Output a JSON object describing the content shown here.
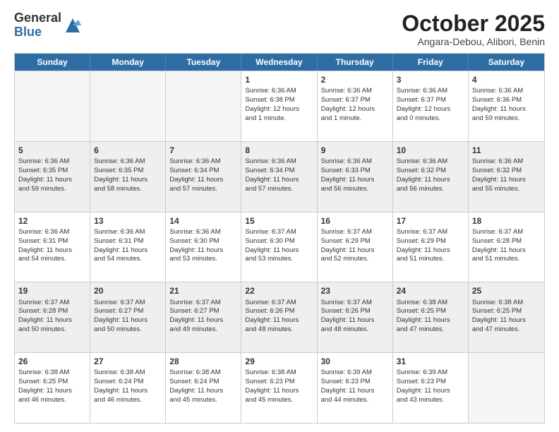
{
  "logo": {
    "general": "General",
    "blue": "Blue"
  },
  "header": {
    "month": "October 2025",
    "location": "Angara-Debou, Alibori, Benin"
  },
  "days": [
    "Sunday",
    "Monday",
    "Tuesday",
    "Wednesday",
    "Thursday",
    "Friday",
    "Saturday"
  ],
  "weeks": [
    [
      {
        "day": "",
        "info": "",
        "empty": true
      },
      {
        "day": "",
        "info": "",
        "empty": true
      },
      {
        "day": "",
        "info": "",
        "empty": true
      },
      {
        "day": "1",
        "info": "Sunrise: 6:36 AM\nSunset: 6:38 PM\nDaylight: 12 hours\nand 1 minute.",
        "empty": false
      },
      {
        "day": "2",
        "info": "Sunrise: 6:36 AM\nSunset: 6:37 PM\nDaylight: 12 hours\nand 1 minute.",
        "empty": false
      },
      {
        "day": "3",
        "info": "Sunrise: 6:36 AM\nSunset: 6:37 PM\nDaylight: 12 hours\nand 0 minutes.",
        "empty": false
      },
      {
        "day": "4",
        "info": "Sunrise: 6:36 AM\nSunset: 6:36 PM\nDaylight: 11 hours\nand 59 minutes.",
        "empty": false
      }
    ],
    [
      {
        "day": "5",
        "info": "Sunrise: 6:36 AM\nSunset: 6:35 PM\nDaylight: 11 hours\nand 59 minutes.",
        "empty": false
      },
      {
        "day": "6",
        "info": "Sunrise: 6:36 AM\nSunset: 6:35 PM\nDaylight: 11 hours\nand 58 minutes.",
        "empty": false
      },
      {
        "day": "7",
        "info": "Sunrise: 6:36 AM\nSunset: 6:34 PM\nDaylight: 11 hours\nand 57 minutes.",
        "empty": false
      },
      {
        "day": "8",
        "info": "Sunrise: 6:36 AM\nSunset: 6:34 PM\nDaylight: 11 hours\nand 57 minutes.",
        "empty": false
      },
      {
        "day": "9",
        "info": "Sunrise: 6:36 AM\nSunset: 6:33 PM\nDaylight: 11 hours\nand 56 minutes.",
        "empty": false
      },
      {
        "day": "10",
        "info": "Sunrise: 6:36 AM\nSunset: 6:32 PM\nDaylight: 11 hours\nand 56 minutes.",
        "empty": false
      },
      {
        "day": "11",
        "info": "Sunrise: 6:36 AM\nSunset: 6:32 PM\nDaylight: 11 hours\nand 55 minutes.",
        "empty": false
      }
    ],
    [
      {
        "day": "12",
        "info": "Sunrise: 6:36 AM\nSunset: 6:31 PM\nDaylight: 11 hours\nand 54 minutes.",
        "empty": false
      },
      {
        "day": "13",
        "info": "Sunrise: 6:36 AM\nSunset: 6:31 PM\nDaylight: 11 hours\nand 54 minutes.",
        "empty": false
      },
      {
        "day": "14",
        "info": "Sunrise: 6:36 AM\nSunset: 6:30 PM\nDaylight: 11 hours\nand 53 minutes.",
        "empty": false
      },
      {
        "day": "15",
        "info": "Sunrise: 6:37 AM\nSunset: 6:30 PM\nDaylight: 11 hours\nand 53 minutes.",
        "empty": false
      },
      {
        "day": "16",
        "info": "Sunrise: 6:37 AM\nSunset: 6:29 PM\nDaylight: 11 hours\nand 52 minutes.",
        "empty": false
      },
      {
        "day": "17",
        "info": "Sunrise: 6:37 AM\nSunset: 6:29 PM\nDaylight: 11 hours\nand 51 minutes.",
        "empty": false
      },
      {
        "day": "18",
        "info": "Sunrise: 6:37 AM\nSunset: 6:28 PM\nDaylight: 11 hours\nand 51 minutes.",
        "empty": false
      }
    ],
    [
      {
        "day": "19",
        "info": "Sunrise: 6:37 AM\nSunset: 6:28 PM\nDaylight: 11 hours\nand 50 minutes.",
        "empty": false
      },
      {
        "day": "20",
        "info": "Sunrise: 6:37 AM\nSunset: 6:27 PM\nDaylight: 11 hours\nand 50 minutes.",
        "empty": false
      },
      {
        "day": "21",
        "info": "Sunrise: 6:37 AM\nSunset: 6:27 PM\nDaylight: 11 hours\nand 49 minutes.",
        "empty": false
      },
      {
        "day": "22",
        "info": "Sunrise: 6:37 AM\nSunset: 6:26 PM\nDaylight: 11 hours\nand 48 minutes.",
        "empty": false
      },
      {
        "day": "23",
        "info": "Sunrise: 6:37 AM\nSunset: 6:26 PM\nDaylight: 11 hours\nand 48 minutes.",
        "empty": false
      },
      {
        "day": "24",
        "info": "Sunrise: 6:38 AM\nSunset: 6:25 PM\nDaylight: 11 hours\nand 47 minutes.",
        "empty": false
      },
      {
        "day": "25",
        "info": "Sunrise: 6:38 AM\nSunset: 6:25 PM\nDaylight: 11 hours\nand 47 minutes.",
        "empty": false
      }
    ],
    [
      {
        "day": "26",
        "info": "Sunrise: 6:38 AM\nSunset: 6:25 PM\nDaylight: 11 hours\nand 46 minutes.",
        "empty": false
      },
      {
        "day": "27",
        "info": "Sunrise: 6:38 AM\nSunset: 6:24 PM\nDaylight: 11 hours\nand 46 minutes.",
        "empty": false
      },
      {
        "day": "28",
        "info": "Sunrise: 6:38 AM\nSunset: 6:24 PM\nDaylight: 11 hours\nand 45 minutes.",
        "empty": false
      },
      {
        "day": "29",
        "info": "Sunrise: 6:38 AM\nSunset: 6:23 PM\nDaylight: 11 hours\nand 45 minutes.",
        "empty": false
      },
      {
        "day": "30",
        "info": "Sunrise: 6:39 AM\nSunset: 6:23 PM\nDaylight: 11 hours\nand 44 minutes.",
        "empty": false
      },
      {
        "day": "31",
        "info": "Sunrise: 6:39 AM\nSunset: 6:23 PM\nDaylight: 11 hours\nand 43 minutes.",
        "empty": false
      },
      {
        "day": "",
        "info": "",
        "empty": true
      }
    ]
  ]
}
